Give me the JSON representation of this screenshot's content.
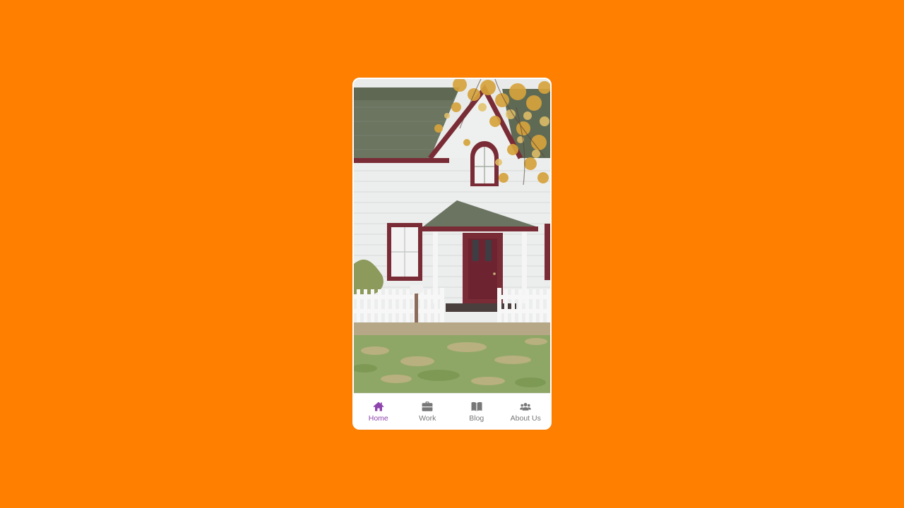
{
  "colors": {
    "background": "#ff8000",
    "active": "#8e44ad",
    "inactive": "#777777"
  },
  "hero": {
    "icon": "house-photo"
  },
  "nav": {
    "items": [
      {
        "label": "Home",
        "icon": "home-icon",
        "active": true
      },
      {
        "label": "Work",
        "icon": "briefcase-icon",
        "active": false
      },
      {
        "label": "Blog",
        "icon": "book-icon",
        "active": false
      },
      {
        "label": "About Us",
        "icon": "users-icon",
        "active": false
      }
    ]
  }
}
